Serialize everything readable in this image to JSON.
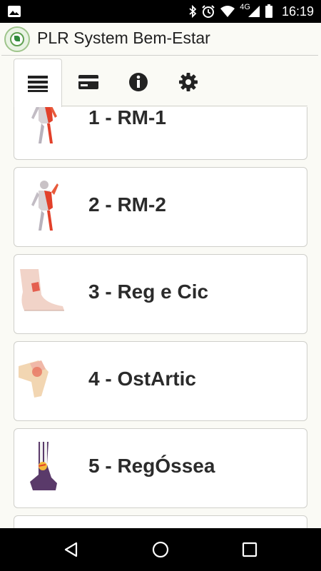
{
  "status_bar": {
    "time": "16:19",
    "network": "4G"
  },
  "app": {
    "title": "PLR System Bem-Estar"
  },
  "tabs": [
    {
      "icon": "list-icon",
      "active": true
    },
    {
      "icon": "card-icon",
      "active": false
    },
    {
      "icon": "info-icon",
      "active": false
    },
    {
      "icon": "gear-icon",
      "active": false
    }
  ],
  "programs": [
    {
      "label": "1 - RM-1",
      "thumb": "body-anatomy-icon"
    },
    {
      "label": "2 - RM-2",
      "thumb": "body-anatomy-icon"
    },
    {
      "label": "3 - Reg e Cic",
      "thumb": "ankle-foot-icon"
    },
    {
      "label": "4 - OstArtic",
      "thumb": "knee-joint-icon"
    },
    {
      "label": "5 - RegÓssea",
      "thumb": "foot-bone-icon"
    },
    {
      "label": "",
      "thumb": ""
    }
  ],
  "colors": {
    "background": "#fafaf5",
    "card": "#ffffff",
    "text": "#2b2b2b",
    "accent_red": "#e2402a"
  }
}
